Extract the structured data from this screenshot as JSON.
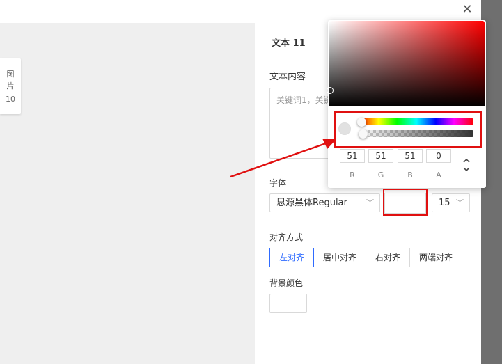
{
  "layers_tab": {
    "line1": "图",
    "line2": "片",
    "count": "10"
  },
  "panel": {
    "title": "文本 11",
    "content_label": "文本内容",
    "content_value": "关键词1，关键",
    "font_label": "字体",
    "font_value": "思源黑体Regular",
    "font_size": "15",
    "align_label": "对齐方式",
    "align_options": [
      "左对齐",
      "居中对齐",
      "右对齐",
      "两端对齐"
    ],
    "bg_label": "背景颜色"
  },
  "color_picker": {
    "base_hue_color": "#ff0000",
    "selected_color": "#333333",
    "r": "51",
    "g": "51",
    "b": "51",
    "a": "0",
    "labels": [
      "R",
      "G",
      "B",
      "A"
    ],
    "mode_toggle_icon": "up-down-chevron-icon"
  },
  "annotation_color": "#e01010",
  "close_icon": "close-icon"
}
